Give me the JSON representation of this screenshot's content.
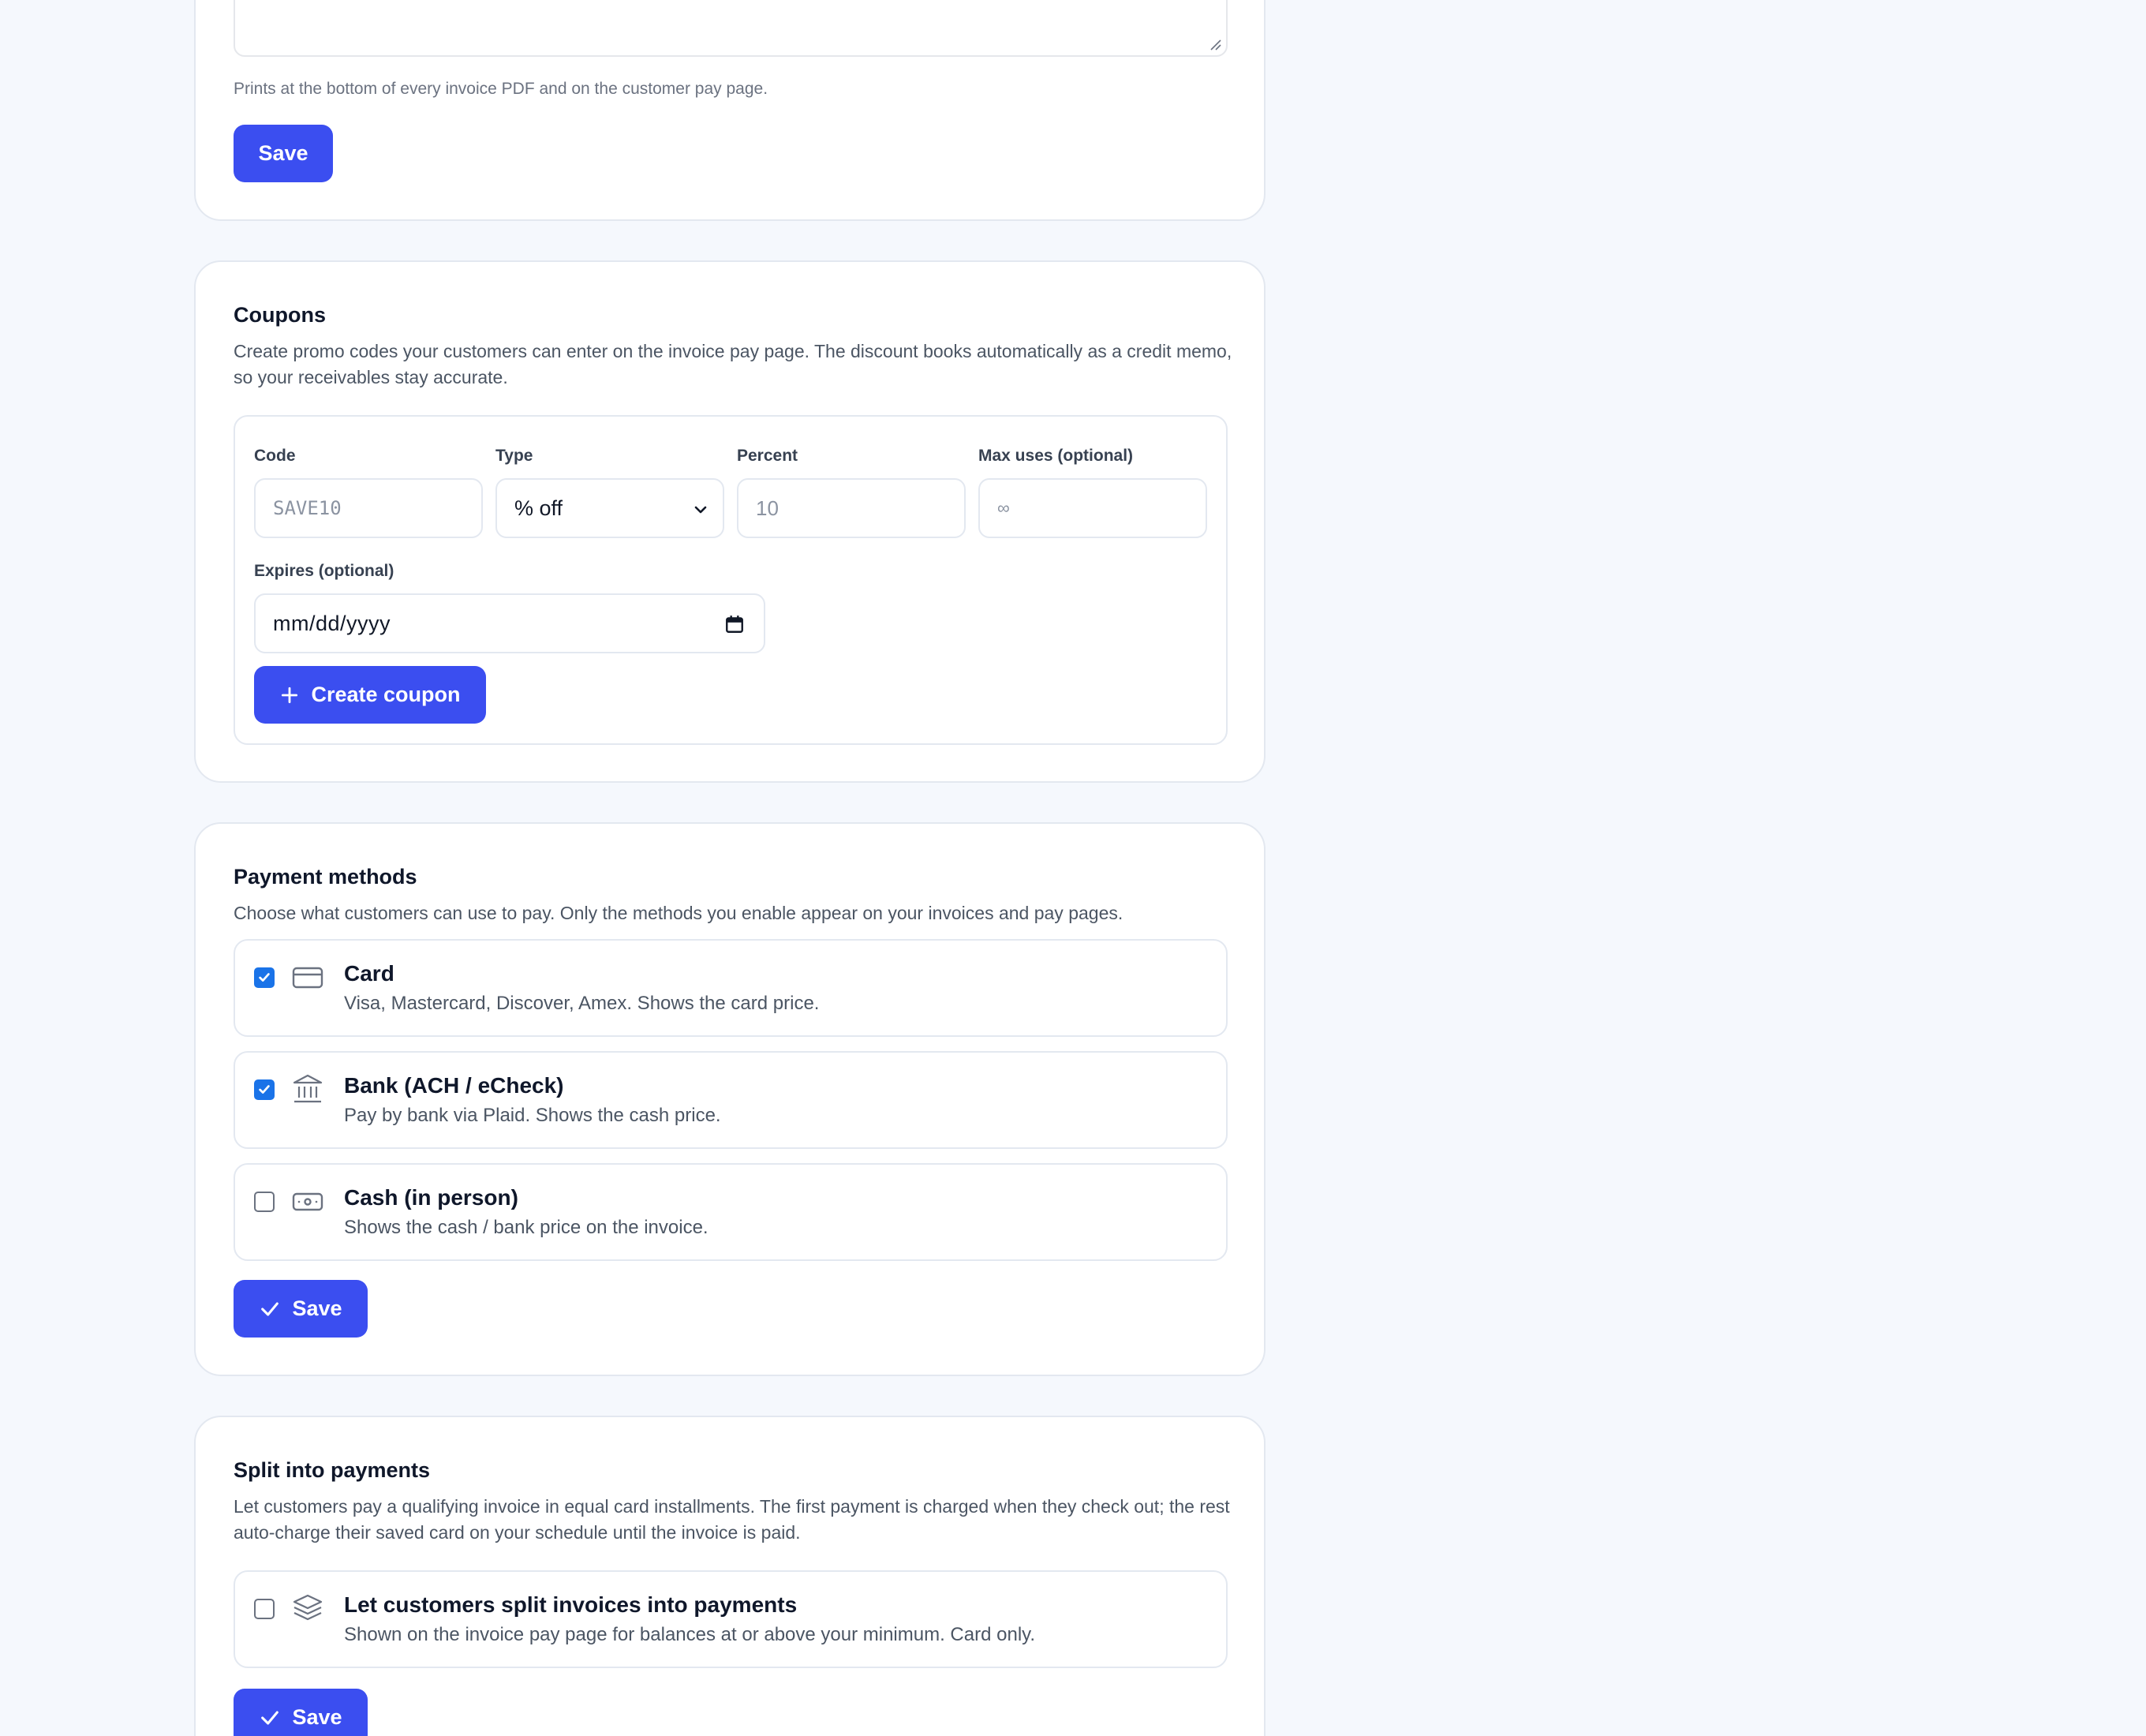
{
  "invoice_footer": {
    "hint": "Prints at the bottom of every invoice PDF and on the customer pay page.",
    "save_label": "Save"
  },
  "coupons": {
    "title": "Coupons",
    "description": "Create promo codes your customers can enter on the invoice pay page. The discount books automatically as a credit memo, so your receivables stay accurate.",
    "fields": {
      "code_label": "Code",
      "code_placeholder": "SAVE10",
      "type_label": "Type",
      "type_value": "% off",
      "percent_label": "Percent",
      "percent_placeholder": "10",
      "max_uses_label": "Max uses (optional)",
      "max_uses_placeholder": "∞",
      "expires_label": "Expires (optional)",
      "expires_placeholder": "mm/dd/yyyy"
    },
    "create_label": "Create coupon"
  },
  "payment_methods": {
    "title": "Payment methods",
    "description": "Choose what customers can use to pay. Only the methods you enable appear on your invoices and pay pages.",
    "options": [
      {
        "title": "Card",
        "description": "Visa, Mastercard, Discover, Amex. Shows the card price.",
        "checked": true,
        "icon": "credit-card-icon"
      },
      {
        "title": "Bank (ACH / eCheck)",
        "description": "Pay by bank via Plaid. Shows the cash price.",
        "checked": true,
        "icon": "bank-icon"
      },
      {
        "title": "Cash (in person)",
        "description": "Shows the cash / bank price on the invoice.",
        "checked": false,
        "icon": "cash-icon"
      }
    ],
    "save_label": "Save"
  },
  "split_payments": {
    "title": "Split into payments",
    "description": "Let customers pay a qualifying invoice in equal card installments. The first payment is charged when they check out; the rest auto-charge their saved card on your schedule until the invoice is paid.",
    "option": {
      "title": "Let customers split invoices into payments",
      "description": "Shown on the invoice pay page for balances at or above your minimum. Card only.",
      "checked": false,
      "icon": "layers-icon"
    },
    "save_label": "Save"
  },
  "colors": {
    "accent": "#3b4ef0",
    "checkbox_checked": "#1a73e8",
    "page_background": "#f5f8fd"
  }
}
